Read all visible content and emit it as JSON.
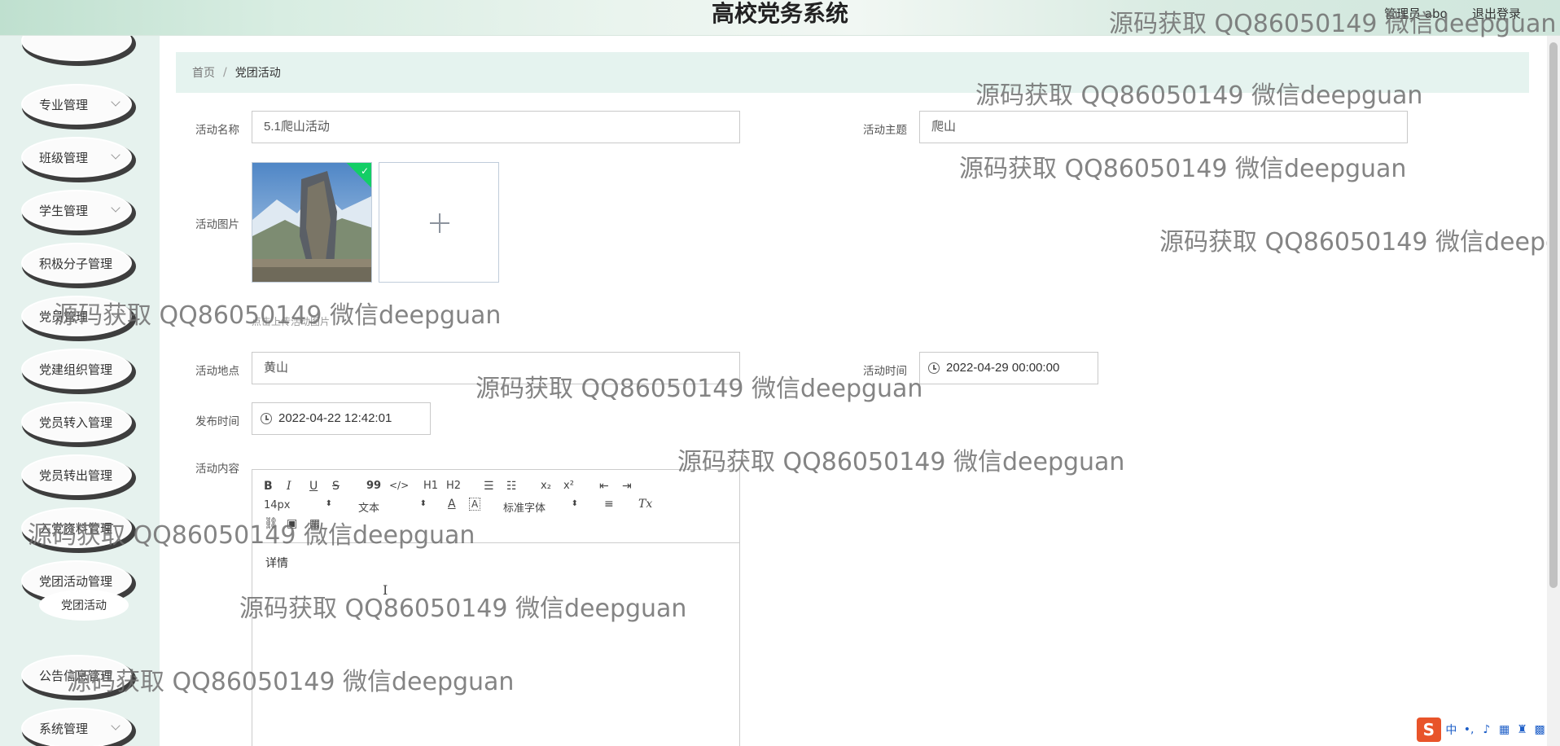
{
  "header": {
    "title": "高校党务系统",
    "user": "管理员 abo",
    "logout": "退出登录"
  },
  "sidebar": {
    "items": [
      {
        "label": "专业管理",
        "chevron": true
      },
      {
        "label": "班级管理",
        "chevron": true
      },
      {
        "label": "学生管理",
        "chevron": true
      },
      {
        "label": "积极分子管理",
        "chevron": false
      },
      {
        "label": "党员管理",
        "chevron": true
      },
      {
        "label": "党建组织管理",
        "chevron": false
      },
      {
        "label": "党员转入管理",
        "chevron": false
      },
      {
        "label": "党员转出管理",
        "chevron": false
      },
      {
        "label": "入党资料管理",
        "chevron": false
      },
      {
        "label": "党团活动管理",
        "chevron": false
      },
      {
        "label": "公告信息管理",
        "chevron": false
      },
      {
        "label": "系统管理",
        "chevron": true
      }
    ],
    "sub_active": "党团活动"
  },
  "breadcrumb": {
    "home": "首页",
    "separator": "/",
    "current": "党团活动"
  },
  "form": {
    "name_label": "活动名称",
    "name_value": "5.1爬山活动",
    "theme_label": "活动主题",
    "theme_value": "爬山",
    "image_label": "活动图片",
    "image_tip": "点击上传活动图片",
    "place_label": "活动地点",
    "place_value": "黄山",
    "time_label": "活动时间",
    "time_value": "2022-04-29 00:00:00",
    "publish_label": "发布时间",
    "publish_value": "2022-04-22 12:42:01",
    "content_label": "活动内容"
  },
  "editor": {
    "buttons": {
      "bold": "B",
      "italic": "I",
      "underline": "U",
      "strike": "S",
      "quote": "99",
      "code": "</>",
      "h1": "H1",
      "h2": "H2",
      "sub": "x₂",
      "sup": "x²",
      "clean": "Tx"
    },
    "size": "14px",
    "header": "文本",
    "font": "标准字体",
    "body": "详情"
  },
  "watermark": "源码获取 QQ86050149 微信deepguan",
  "icons": {
    "logo": "sogou-s-icon",
    "clock": "clock-icon",
    "plus": "plus-icon"
  },
  "colors": {
    "sidebar_bg": "#e6f2ee",
    "breadcrumb_bg": "#e5f3ef",
    "success": "#13ce66"
  }
}
